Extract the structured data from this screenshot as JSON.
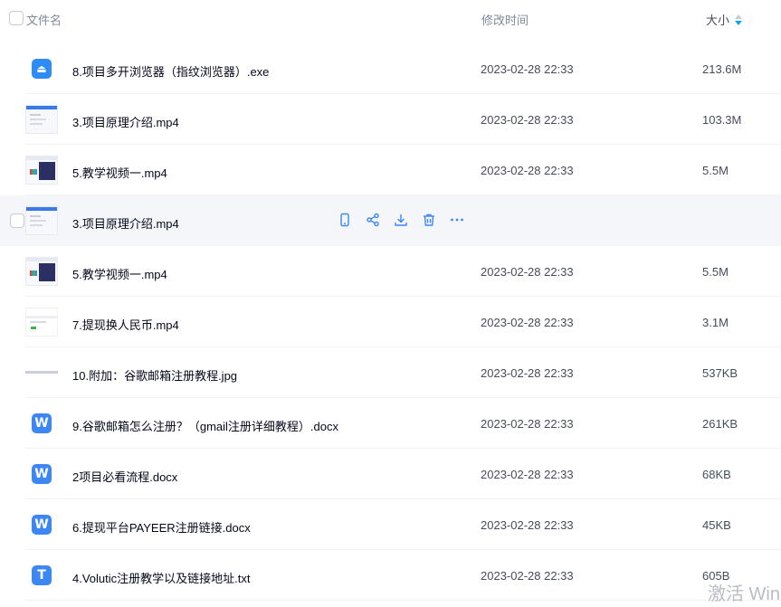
{
  "header": {
    "name": "文件名",
    "time": "修改时间",
    "size": "大小"
  },
  "colors": {
    "accent": "#06a7ff",
    "doc": "#3c86f6",
    "action": "#3c86f6"
  },
  "files": [
    {
      "name": "8.项目多开浏览器（指纹浏览器）.exe",
      "time": "2023-02-28 22:33",
      "size": "213.6M",
      "kind": "exe"
    },
    {
      "name": "3.项目原理介绍.mp4",
      "time": "2023-02-28 22:33",
      "size": "103.3M",
      "kind": "thumb-blue"
    },
    {
      "name": "5.教学视频一.mp4",
      "time": "2023-02-28 22:33",
      "size": "5.5M",
      "kind": "thumb-dark"
    },
    {
      "name": "3.项目原理介绍.mp4",
      "time": "",
      "size": "",
      "kind": "thumb-blue",
      "hover": true
    },
    {
      "name": "5.教学视频一.mp4",
      "time": "2023-02-28 22:33",
      "size": "5.5M",
      "kind": "thumb-dark"
    },
    {
      "name": "7.提现换人民币.mp4",
      "time": "2023-02-28 22:33",
      "size": "3.1M",
      "kind": "thumb-green"
    },
    {
      "name": "10.附加：谷歌邮箱注册教程.jpg",
      "time": "2023-02-28 22:33",
      "size": "537KB",
      "kind": "strip"
    },
    {
      "name": "9.谷歌邮箱怎么注册？（gmail注册详细教程）.docx",
      "time": "2023-02-28 22:33",
      "size": "261KB",
      "kind": "doc"
    },
    {
      "name": "2项目必看流程.docx",
      "time": "2023-02-28 22:33",
      "size": "68KB",
      "kind": "doc"
    },
    {
      "name": "6.提现平台PAYEER注册链接.docx",
      "time": "2023-02-28 22:33",
      "size": "45KB",
      "kind": "doc"
    },
    {
      "name": "4.Volutic注册教学以及链接地址.txt",
      "time": "2023-02-28 22:33",
      "size": "605B",
      "kind": "txt"
    }
  ],
  "hover_actions": [
    "phone-icon",
    "share-icon",
    "download-icon",
    "delete-icon",
    "more-icon"
  ],
  "watermark": "激活 Win"
}
